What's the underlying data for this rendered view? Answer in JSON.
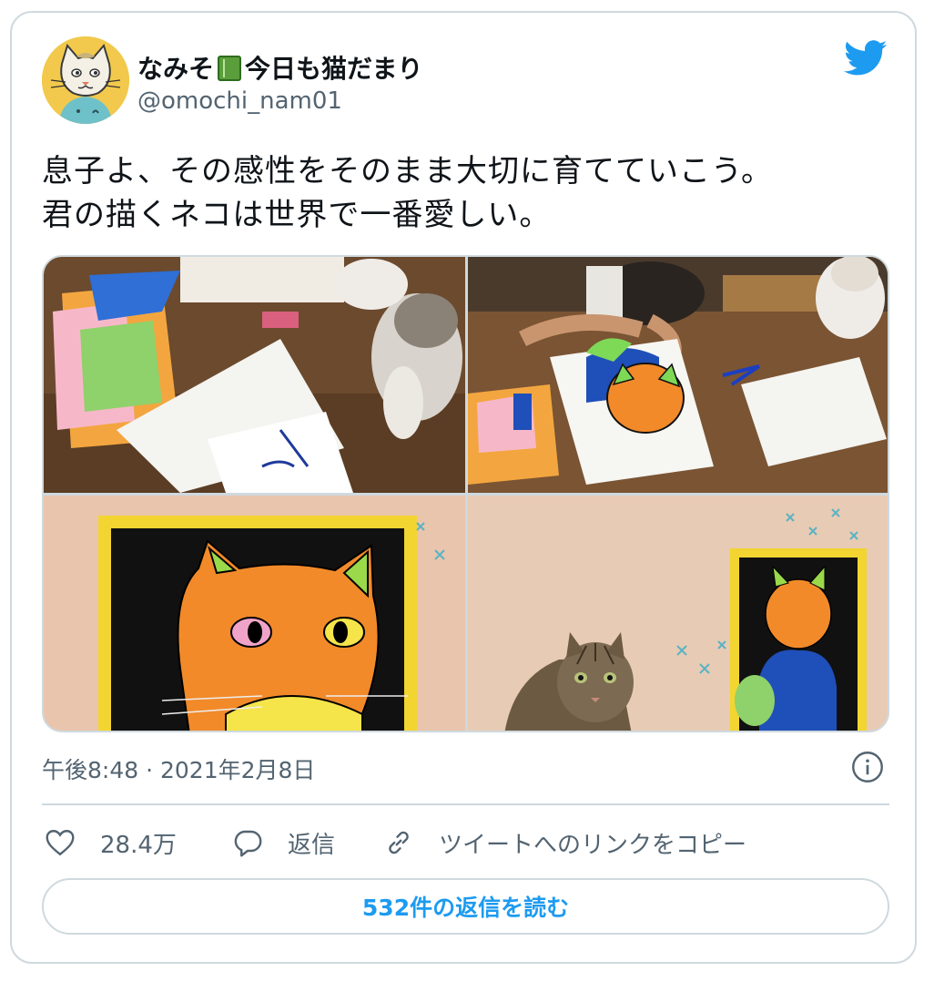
{
  "author": {
    "name_part1": "なみそ",
    "name_part2": "今日も猫だまり",
    "handle": "@omochi_nam01",
    "avatar_icon": "cat-avatar-icon"
  },
  "brand": {
    "icon": "twitter-bird-icon",
    "color": "#1d9bf0"
  },
  "tweet": {
    "line1": "息子よ、その感性をそのまま大切に育てていこう。",
    "line2": "君の描くネコは世界で一番愛しい。"
  },
  "media": {
    "photo_count": 4
  },
  "meta": {
    "time": "午後8:48",
    "separator": "·",
    "date": "2021年2月8日",
    "info_icon": "info-icon"
  },
  "actions": {
    "like_count": "28.4万",
    "reply_label": "返信",
    "copy_link_label": "ツイートへのリンクをコピー"
  },
  "read_replies_label": "532件の返信を読む",
  "colors": {
    "accent": "#1d9bf0",
    "secondary_text": "#536471",
    "border": "#cfd9de"
  }
}
